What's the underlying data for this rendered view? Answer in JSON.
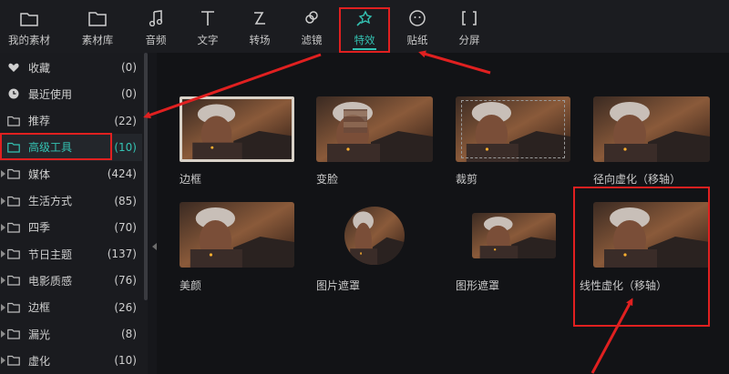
{
  "toolbar": {
    "items": [
      {
        "label": "我的素材",
        "icon": "folder-icon"
      },
      {
        "label": "素材库",
        "icon": "folder-outline-icon"
      },
      {
        "label": "音频",
        "icon": "music-note-icon"
      },
      {
        "label": "文字",
        "icon": "text-icon"
      },
      {
        "label": "转场",
        "icon": "transition-icon"
      },
      {
        "label": "滤镜",
        "icon": "filter-icon"
      },
      {
        "label": "特效",
        "icon": "magic-wand-icon"
      },
      {
        "label": "贴纸",
        "icon": "sticker-icon"
      },
      {
        "label": "分屏",
        "icon": "split-screen-icon"
      }
    ],
    "active": "特效"
  },
  "sidebar": {
    "items": [
      {
        "label": "收藏",
        "count": "(0)",
        "icon": "heart-icon"
      },
      {
        "label": "最近使用",
        "count": "(0)",
        "icon": "clock-icon"
      },
      {
        "label": "推荐",
        "count": "(22)",
        "icon": "folder-icon"
      },
      {
        "label": "高级工具",
        "count": "(10)",
        "icon": "folder-icon",
        "selected": true
      },
      {
        "label": "媒体",
        "count": "(424)",
        "icon": "folder-icon"
      },
      {
        "label": "生活方式",
        "count": "(85)",
        "icon": "folder-icon"
      },
      {
        "label": "四季",
        "count": "(70)",
        "icon": "folder-icon"
      },
      {
        "label": "节日主题",
        "count": "(137)",
        "icon": "folder-icon"
      },
      {
        "label": "电影质感",
        "count": "(76)",
        "icon": "folder-icon"
      },
      {
        "label": "边框",
        "count": "(26)",
        "icon": "folder-icon"
      },
      {
        "label": "漏光",
        "count": "(8)",
        "icon": "folder-icon"
      },
      {
        "label": "虚化",
        "count": "(10)",
        "icon": "folder-icon"
      }
    ]
  },
  "effects": [
    {
      "label": "边框"
    },
    {
      "label": "变脸"
    },
    {
      "label": "裁剪"
    },
    {
      "label": "径向虚化（移轴）"
    },
    {
      "label": "美颜"
    },
    {
      "label": "图片遮罩"
    },
    {
      "label": "图形遮罩"
    },
    {
      "label": "线性虚化（移轴）"
    }
  ],
  "colors": {
    "accent": "#34c3b3",
    "highlight": "#e02020",
    "background": "#121316"
  }
}
